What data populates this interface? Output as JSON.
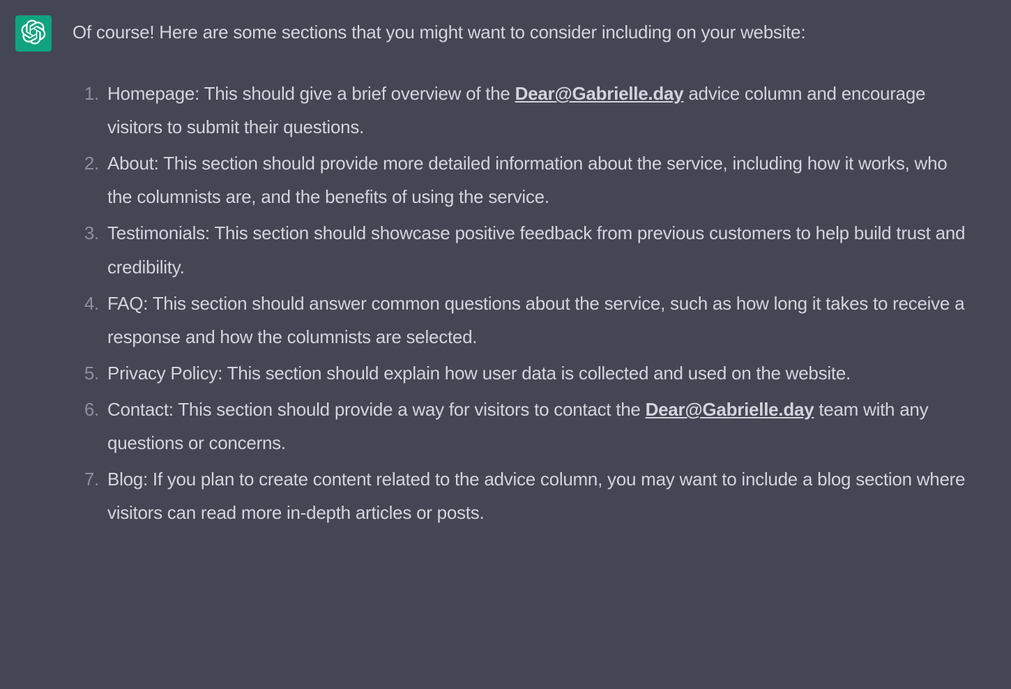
{
  "avatar": {
    "name": "chatgpt-avatar"
  },
  "intro": "Of course! Here are some sections that you might want to consider including on your website:",
  "items": [
    {
      "prefix": "Homepage: This should give a brief overview of the ",
      "link": "Dear@Gabrielle.day",
      "suffix": " advice column and encourage visitors to submit their questions."
    },
    {
      "prefix": "About: This section should provide more detailed information about the service, including how it works, who the columnists are, and the benefits of using the service.",
      "link": "",
      "suffix": ""
    },
    {
      "prefix": "Testimonials: This section should showcase positive feedback from previous customers to help build trust and credibility.",
      "link": "",
      "suffix": ""
    },
    {
      "prefix": "FAQ: This section should answer common questions about the service, such as how long it takes to receive a response and how the columnists are selected.",
      "link": "",
      "suffix": ""
    },
    {
      "prefix": "Privacy Policy: This section should explain how user data is collected and used on the website.",
      "link": "",
      "suffix": ""
    },
    {
      "prefix": "Contact: This section should provide a way for visitors to contact the ",
      "link": "Dear@Gabrielle.day",
      "suffix": " team with any questions or concerns."
    },
    {
      "prefix": "Blog: If you plan to create content related to the advice column, you may want to include a blog section where visitors can read more in-depth articles or posts.",
      "link": "",
      "suffix": ""
    }
  ]
}
